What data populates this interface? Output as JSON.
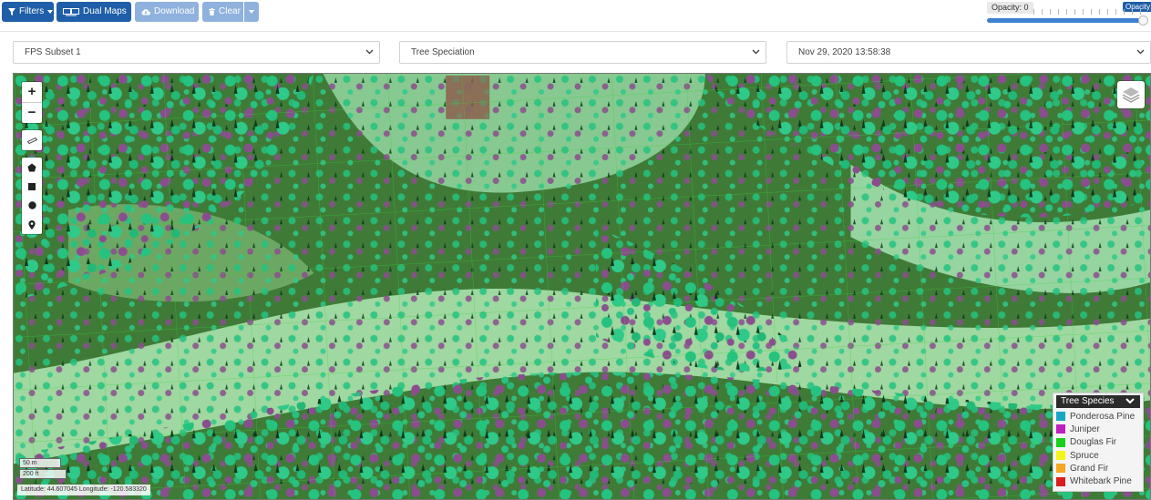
{
  "toolbar": {
    "filters_label": "Filters",
    "dual_maps_label": "Dual Maps",
    "download_label": "Download",
    "clear_label": "Clear"
  },
  "opacity": {
    "label": "Opacity: 0",
    "max_label": "Opacity:",
    "value": 1.0
  },
  "selects": {
    "subset": "FPS Subset 1",
    "analysis": "Tree Speciation",
    "date": "Nov 29, 2020 13:58:38"
  },
  "map": {
    "zoom_in": "+",
    "zoom_out": "−",
    "scale_metric": "50 m",
    "scale_imperial": "200 ft",
    "coordinates": "Latitude: 44.607045 Longitude: -120.583320"
  },
  "legend": {
    "title": "Tree Species",
    "items": [
      {
        "label": "Ponderosa Pine",
        "color": "#18a6c6"
      },
      {
        "label": "Juniper",
        "color": "#c01fc0"
      },
      {
        "label": "Douglas Fir",
        "color": "#18d018"
      },
      {
        "label": "Spruce",
        "color": "#f5f518"
      },
      {
        "label": "Grand Fir",
        "color": "#f5a623"
      },
      {
        "label": "Whitebark Pine",
        "color": "#d81f1f"
      }
    ]
  },
  "colors": {
    "primary": "#1f5ea8",
    "primary_light": "#8fb1de",
    "canopy_teal": "#25c280",
    "canopy_purple": "#8a4e8f"
  },
  "icons": [
    "filter-icon",
    "monitor-icon",
    "cloud-download-icon",
    "trash-icon",
    "chevron-down-icon",
    "layers-icon",
    "ruler-icon",
    "polygon-icon",
    "square-icon",
    "circle-icon",
    "marker-icon"
  ]
}
